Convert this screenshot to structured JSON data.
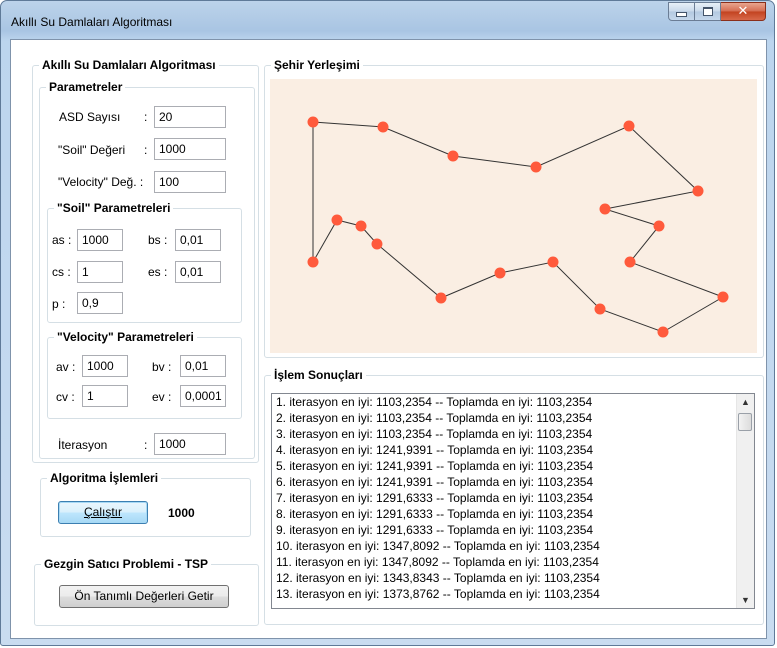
{
  "window": {
    "title": "Akıllı Su Damlaları Algoritması"
  },
  "left_panel": {
    "title": "Akıllı Su Damlaları Algoritması",
    "parametreler": {
      "title": "Parametreler",
      "asd_label": "ASD Sayısı",
      "asd_colon": ":",
      "asd_value": "20",
      "soil_label": "\"Soil\" Değeri",
      "soil_colon": ":",
      "soil_value": "1000",
      "velocity_label": "\"Velocity\" Değ. :",
      "velocity_value": "100"
    },
    "soil_params": {
      "title": "\"Soil\" Parametreleri",
      "as_label": "as :",
      "as_value": "1000",
      "bs_label": "bs :",
      "bs_value": "0,01",
      "cs_label": "cs :",
      "cs_value": "1",
      "es_label": "es :",
      "es_value": "0,01",
      "p_label": "p :",
      "p_value": "0,9"
    },
    "velocity_params": {
      "title": "\"Velocity\" Parametreleri",
      "av_label": "av :",
      "av_value": "1000",
      "bv_label": "bv :",
      "bv_value": "0,01",
      "cv_label": "cv :",
      "cv_value": "1",
      "ev_label": "ev :",
      "ev_value": "0,0001"
    },
    "iterasyon_label": "İterasyon",
    "iterasyon_colon": ":",
    "iterasyon_value": "1000"
  },
  "algoritma": {
    "title": "Algoritma İşlemleri",
    "run_button": "Çalıştır",
    "result": "1000"
  },
  "tsp": {
    "title": "Gezgin Satıcı Problemi - TSP",
    "defaults_button": "Ön Tanımlı Değerleri Getir"
  },
  "map": {
    "title": "Şehir Yerleşimi",
    "background": "#faeee3",
    "point_color": "#ff5a3c",
    "line_color": "#333333"
  },
  "results": {
    "title": "İşlem Sonuçları",
    "rows": [
      "1. iterasyon en iyi: 1103,2354 -- Toplamda en iyi: 1103,2354",
      "2. iterasyon en iyi: 1103,2354 -- Toplamda en iyi: 1103,2354",
      "3. iterasyon en iyi: 1103,2354 -- Toplamda en iyi: 1103,2354",
      "4. iterasyon en iyi: 1241,9391 -- Toplamda en iyi: 1103,2354",
      "5. iterasyon en iyi: 1241,9391 -- Toplamda en iyi: 1103,2354",
      "6. iterasyon en iyi: 1241,9391 -- Toplamda en iyi: 1103,2354",
      "7. iterasyon en iyi: 1291,6333 -- Toplamda en iyi: 1103,2354",
      "8. iterasyon en iyi: 1291,6333 -- Toplamda en iyi: 1103,2354",
      "9. iterasyon en iyi: 1291,6333 -- Toplamda en iyi: 1103,2354",
      "10. iterasyon en iyi: 1347,8092 -- Toplamda en iyi: 1103,2354",
      "11. iterasyon en iyi: 1347,8092 -- Toplamda en iyi: 1103,2354",
      "12. iterasyon en iyi: 1343,8343 -- Toplamda en iyi: 1103,2354",
      "13. iterasyon en iyi: 1373,8762 -- Toplamda en iyi: 1103,2354"
    ]
  }
}
